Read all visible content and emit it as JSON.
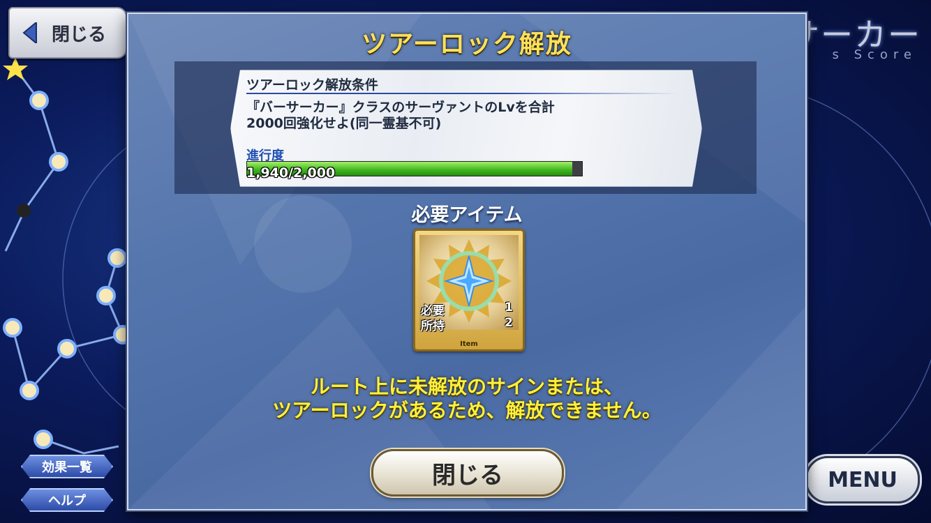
{
  "top_left": {
    "close_label": "閉じる"
  },
  "class_header": {
    "title": "バーサーカー",
    "subtitle": "s Score"
  },
  "side_buttons": {
    "effects_label": "効果一覧",
    "help_label": "ヘルプ"
  },
  "menu": {
    "label": "MENU"
  },
  "dialog": {
    "title": "ツアーロック解放",
    "condition": {
      "heading": "ツアーロック解放条件",
      "text": "『バーサーカー』クラスのサーヴァントのLvを合計\n2000回強化せよ(同一霊基不可)",
      "progress_label": "進行度",
      "progress_text": "1,940/2,000",
      "progress_fraction": 0.97
    },
    "required_items": {
      "title": "必要アイテム",
      "item": {
        "required_label": "必要",
        "required_count": "1",
        "owned_label": "所持",
        "owned_count": "2",
        "tag": "Item",
        "icon": "star-crystal-icon"
      }
    },
    "message": "ルート上に未解放のサインまたは、\nツアーロックがあるため、解放できません。",
    "close_label": "閉じる"
  },
  "colors": {
    "title_yellow": "#ffe15a",
    "message_yellow": "#fff03c",
    "progress_green": "#3bb51d",
    "dialog_blue": "#5576ad"
  }
}
